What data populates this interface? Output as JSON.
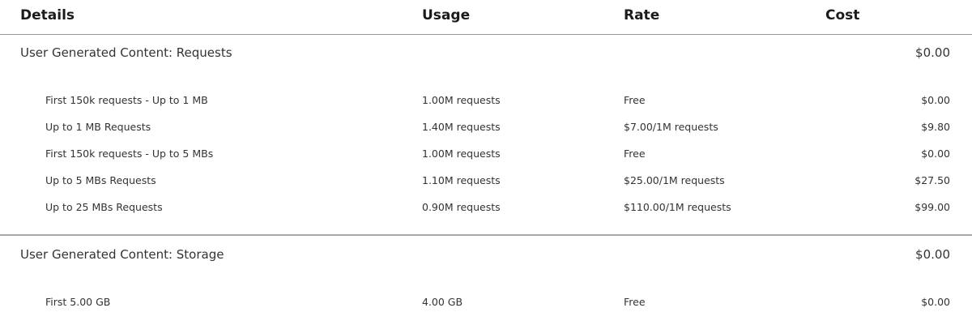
{
  "header": {
    "details": "Details",
    "usage": "Usage",
    "rate": "Rate",
    "cost": "Cost"
  },
  "sections": [
    {
      "title": "User Generated Content: Requests",
      "total": "$0.00",
      "rows": [
        {
          "detail": "First 150k requests - Up to 1 MB",
          "usage": "1.00M requests",
          "rate": "Free",
          "cost": "$0.00"
        },
        {
          "detail": "Up to 1 MB Requests",
          "usage": "1.40M requests",
          "rate": "$7.00/1M requests",
          "cost": "$9.80"
        },
        {
          "detail": "First 150k requests - Up to 5 MBs",
          "usage": "1.00M requests",
          "rate": "Free",
          "cost": "$0.00"
        },
        {
          "detail": "Up to 5 MBs Requests",
          "usage": "1.10M requests",
          "rate": "$25.00/1M requests",
          "cost": "$27.50"
        },
        {
          "detail": "Up to 25 MBs Requests",
          "usage": "0.90M requests",
          "rate": "$110.00/1M requests",
          "cost": "$99.00"
        }
      ]
    },
    {
      "title": "User Generated Content: Storage",
      "total": "$0.00",
      "rows": [
        {
          "detail": "First 5.00 GB",
          "usage": "4.00 GB",
          "rate": "Free",
          "cost": "$0.00"
        }
      ]
    }
  ]
}
